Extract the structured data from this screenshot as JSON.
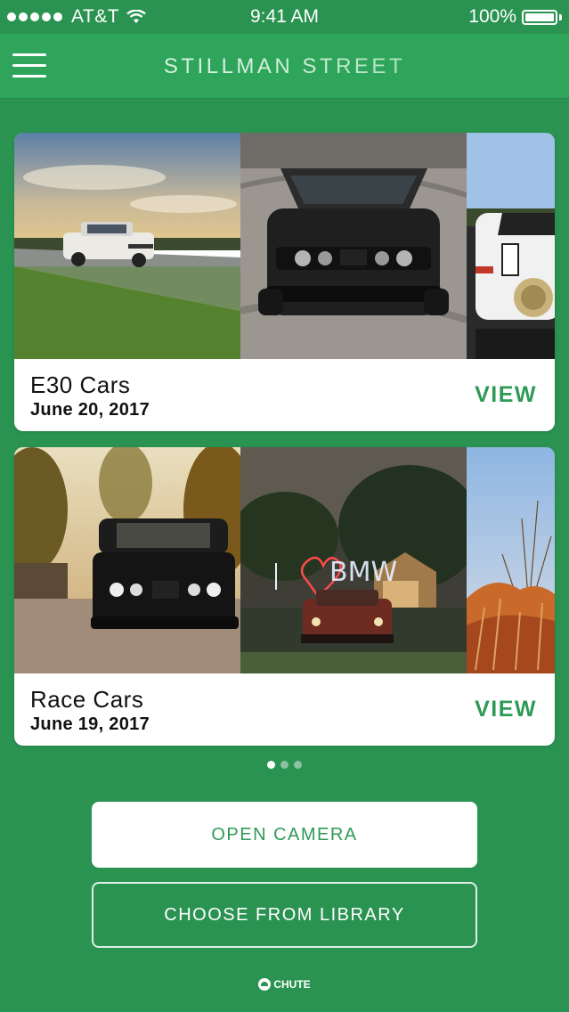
{
  "status_bar": {
    "carrier": "AT&T",
    "time": "9:41 AM",
    "battery": "100%",
    "battery_level": 1.0,
    "signal_icon": "signal-dots-icon",
    "wifi_icon": "wifi-icon",
    "battery_icon": "battery-icon"
  },
  "header": {
    "title": "STILLMAN STREET",
    "menu_icon": "hamburger-menu-icon"
  },
  "albums": [
    {
      "name": "E30 Cars",
      "date": "June 20, 2017",
      "view_label": "VIEW",
      "photos": [
        "white-bmw-e30-road-photo",
        "black-bmw-e30-drift-photo",
        "race-bmw-e30-photo"
      ]
    },
    {
      "name": "Race Cars",
      "date": "June 19, 2017",
      "view_label": "VIEW",
      "photos": [
        "black-bmw-m3-photo",
        "bmw-light-painting-photo",
        "autumn-grass-photo"
      ]
    }
  ],
  "pager": {
    "pages": 3,
    "active_index": 0
  },
  "actions": {
    "open_camera": "OPEN CAMERA",
    "choose_library": "CHOOSE FROM LIBRARY"
  },
  "footer": {
    "brand": "CHUTE",
    "logo_icon": "chute-logo-icon"
  },
  "colors": {
    "background": "#2a9351",
    "nav_bar": "#2fa55b",
    "accent_green": "#2f9a57",
    "card_white": "#ffffff"
  }
}
